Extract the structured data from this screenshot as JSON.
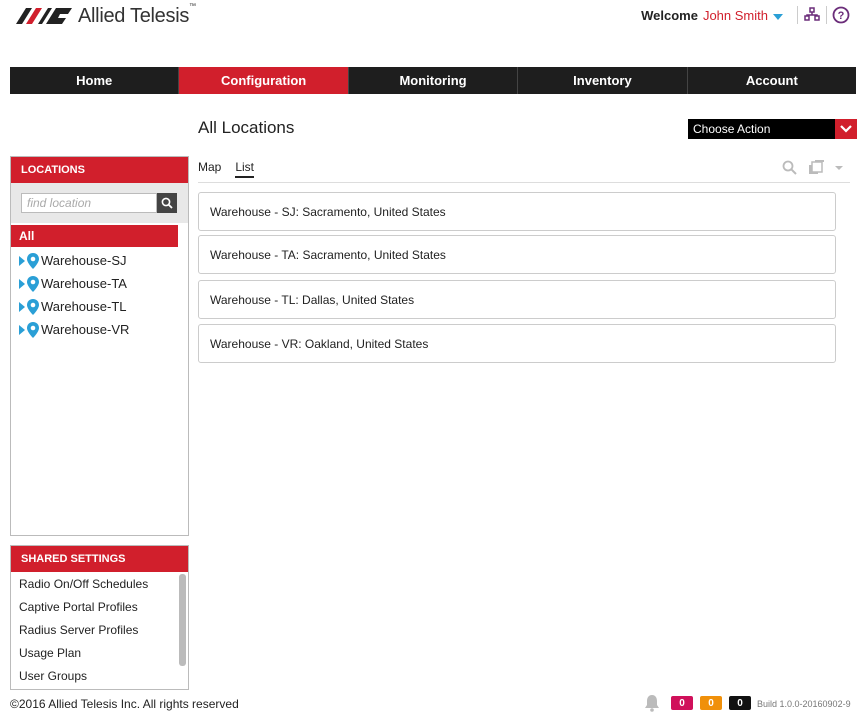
{
  "header": {
    "logo_text": "Allied Telesis",
    "logo_tm": "™",
    "welcome_label": "Welcome",
    "user_name": "John Smith"
  },
  "nav": {
    "items": [
      "Home",
      "Configuration",
      "Monitoring",
      "Inventory",
      "Account"
    ],
    "active_index": 1
  },
  "main": {
    "title": "All Locations",
    "choose_action": "Choose Action",
    "tabs": [
      "Map",
      "List"
    ],
    "active_tab": "List",
    "locations": [
      "Warehouse - SJ: Sacramento, United States",
      "Warehouse - TA: Sacramento, United States",
      "Warehouse - TL: Dallas, United States",
      "Warehouse - VR: Oakland, United States"
    ]
  },
  "sidebar": {
    "locations_header": "LOCATIONS",
    "search_placeholder": "find location",
    "all_label": "All",
    "items": [
      "Warehouse-SJ",
      "Warehouse-TA",
      "Warehouse-TL",
      "Warehouse-VR"
    ],
    "shared_header": "SHARED SETTINGS",
    "shared_items": [
      "Radio On/Off Schedules",
      "Captive Portal Profiles",
      "Radius Server Profiles",
      "Usage Plan",
      "User Groups"
    ]
  },
  "footer": {
    "copyright": "©2016 Allied Telesis Inc. All rights reserved",
    "alerts": [
      {
        "count": "0",
        "color": "#d0105a"
      },
      {
        "count": "0",
        "color": "#f0900a"
      },
      {
        "count": "0",
        "color": "#111111"
      }
    ],
    "build": "Build 1.0.0-20160902-9"
  },
  "colors": {
    "accent": "#d11f2c",
    "nav_bg": "#1e1e1e",
    "pin": "#2a9fd6"
  }
}
